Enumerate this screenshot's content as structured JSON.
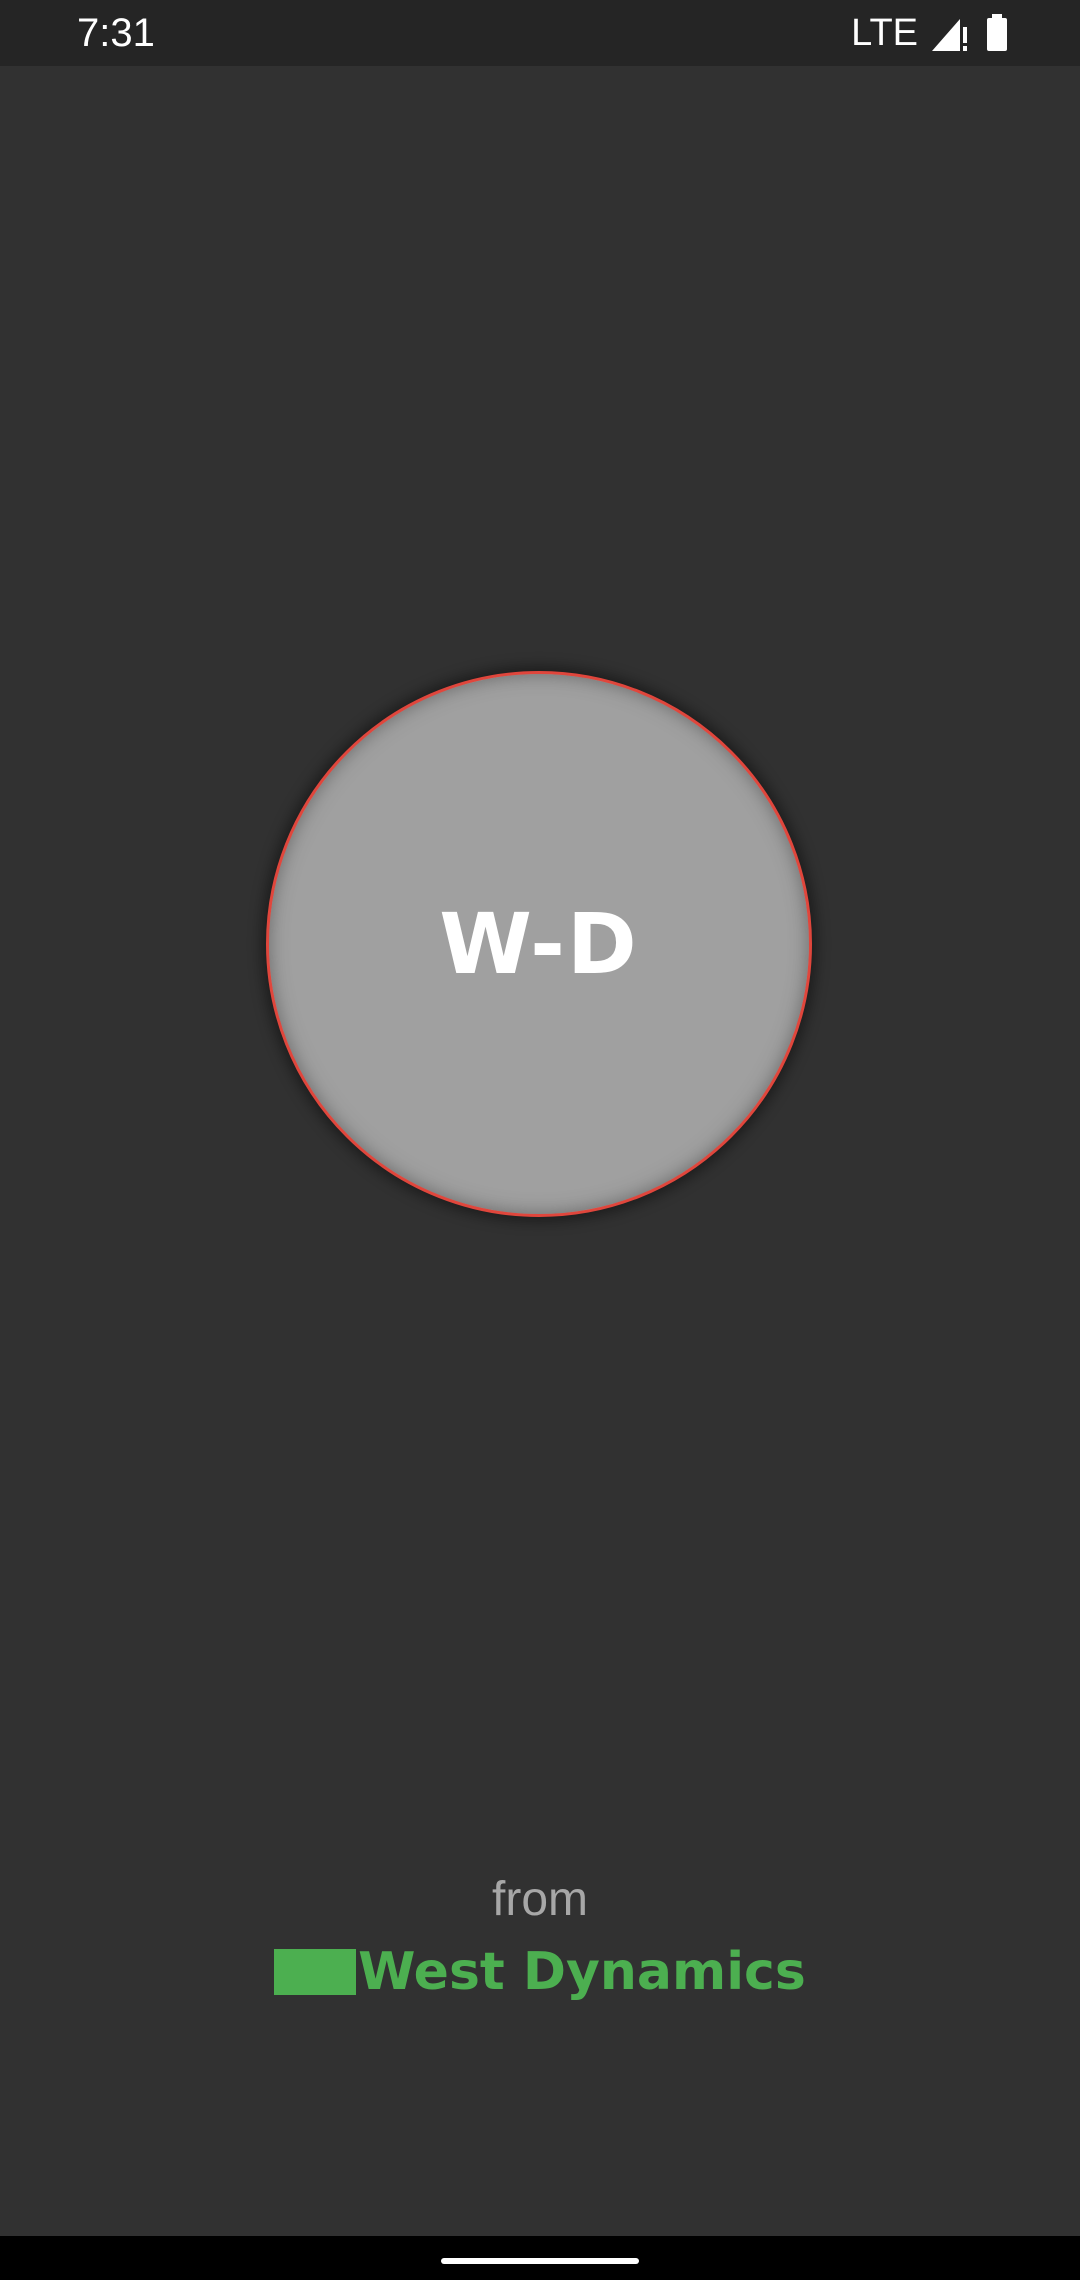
{
  "status_bar": {
    "time": "7:31",
    "network": "LTE",
    "icons": [
      "signal-icon",
      "battery-icon"
    ]
  },
  "splash": {
    "logo_text": "W-D",
    "from_label": "from",
    "company_name": "West Dynamics"
  },
  "colors": {
    "background": "#313131",
    "circle_fill": "#a0a0a0",
    "circle_border": "#e0463c",
    "brand_green": "#4caf50",
    "from_text": "#a7a7a7"
  }
}
